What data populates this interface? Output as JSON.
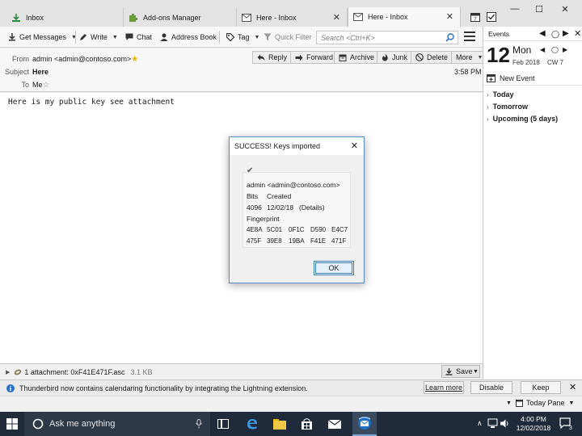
{
  "tabs": [
    {
      "label": "Inbox",
      "icon": "inbox-icon"
    },
    {
      "label": "Add-ons Manager",
      "icon": "puzzle-icon"
    },
    {
      "label": "Here - Inbox",
      "icon": "mail-icon"
    },
    {
      "label": "Here - Inbox",
      "icon": "mail-icon"
    }
  ],
  "toolbar": {
    "get_messages": "Get Messages",
    "write": "Write",
    "chat": "Chat",
    "address_book": "Address Book",
    "tag": "Tag",
    "quick_filter": "Quick Filter",
    "search_placeholder": "Search <Ctrl+K>"
  },
  "header": {
    "from_label": "From",
    "from_value": "admin <admin@contoso.com>",
    "subject_label": "Subject",
    "subject_value": "Here",
    "to_label": "To",
    "to_value": "Me",
    "time": "3:58 PM",
    "reply": "Reply",
    "forward": "Forward",
    "archive": "Archive",
    "junk": "Junk",
    "delete": "Delete",
    "more": "More"
  },
  "body": {
    "text": "Here is my public key see attachment"
  },
  "attachment": {
    "label": "1 attachment: 0xF41E471F.asc",
    "size": "3.1 KB",
    "save": "Save"
  },
  "events": {
    "title": "Events",
    "day": "12",
    "weekday": "Mon",
    "month_year": "Feb 2018",
    "cw": "CW 7",
    "new_event": "New Event",
    "groups": [
      "Today",
      "Tomorrow",
      "Upcoming (5 days)"
    ]
  },
  "notification": {
    "text": "Thunderbird now contains calendaring functionality by integrating the Lightning extension.",
    "learn_more": "Learn more",
    "disable": "Disable",
    "keep": "Keep"
  },
  "statusbar": {
    "today_pane": "Today Pane"
  },
  "dialog": {
    "title": "SUCCESS! Keys imported",
    "key_user": "admin <admin@contoso.com>",
    "bits_label": "Bits",
    "created_label": "Created",
    "bits_value": "4096",
    "created_value": "12/02/18",
    "details": "(Details)",
    "fingerprint_label": "Fingerprint",
    "fingerprint_row1": [
      "4E8A",
      "5C01",
      "0F1C",
      "D590",
      "E4C7"
    ],
    "fingerprint_row2": [
      "475F",
      "39E8",
      "19BA",
      "F41E",
      "471F"
    ],
    "ok": "OK"
  },
  "taskbar": {
    "search_placeholder": "Ask me anything",
    "time": "4:00 PM",
    "date": "12/02/2018",
    "notification_count": "3"
  },
  "colors": {
    "accent": "#3c7fb1",
    "taskbar": "#1f2b3a",
    "info_icon": "#2a6fc9"
  }
}
